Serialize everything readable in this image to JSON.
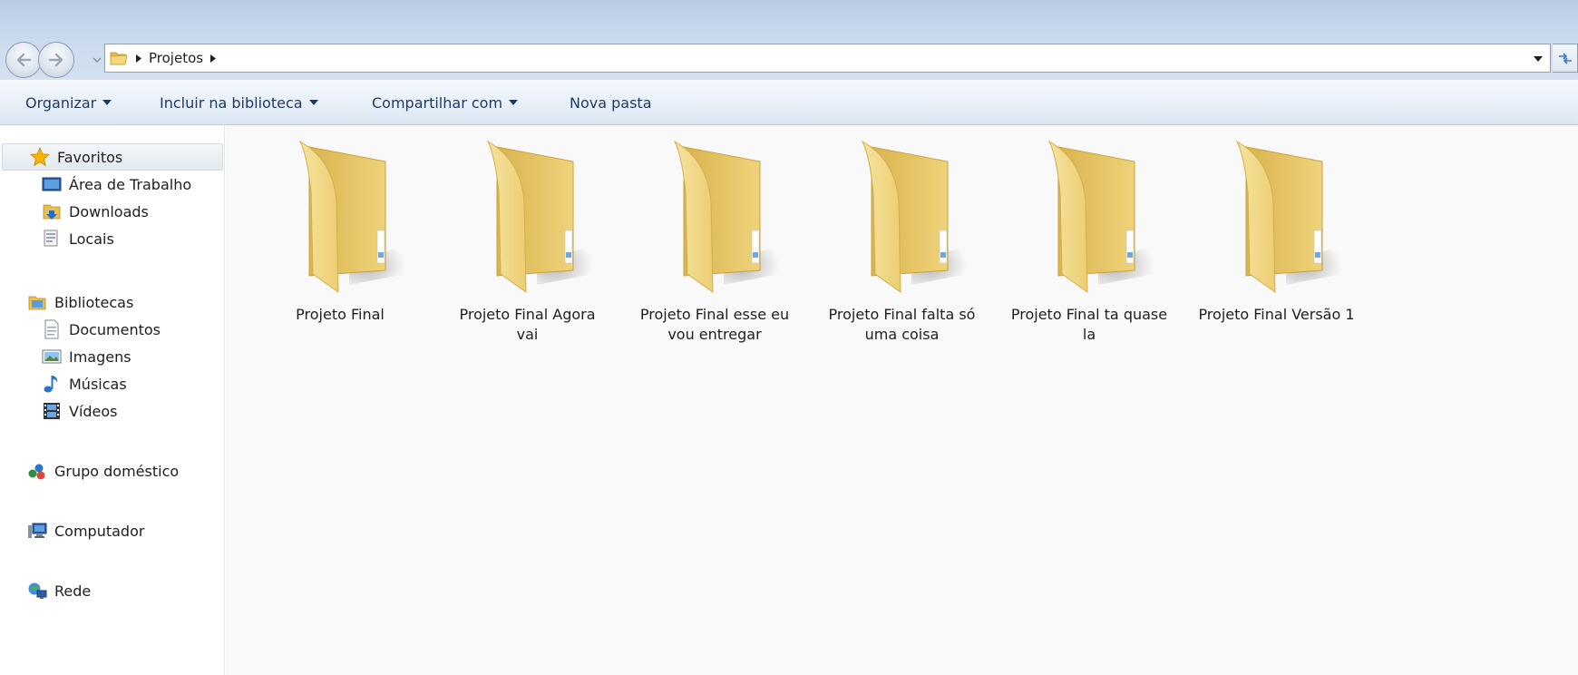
{
  "breadcrumb": {
    "current": "Projetos"
  },
  "toolbar": {
    "organize": "Organizar",
    "include_library": "Incluir na biblioteca",
    "share": "Compartilhar com",
    "new_folder": "Nova pasta"
  },
  "sidebar": {
    "favorites": {
      "label": "Favoritos",
      "items": [
        {
          "label": "Área de Trabalho",
          "icon": "desktop-icon"
        },
        {
          "label": "Downloads",
          "icon": "downloads-folder-icon"
        },
        {
          "label": "Locais",
          "icon": "recent-places-icon"
        }
      ]
    },
    "libraries": {
      "label": "Bibliotecas",
      "items": [
        {
          "label": "Documentos",
          "icon": "documents-icon"
        },
        {
          "label": "Imagens",
          "icon": "pictures-icon"
        },
        {
          "label": "Músicas",
          "icon": "music-note-icon"
        },
        {
          "label": "Vídeos",
          "icon": "video-film-icon"
        }
      ]
    },
    "homegroup": {
      "label": "Grupo doméstico",
      "icon": "homegroup-icon"
    },
    "computer": {
      "label": "Computador",
      "icon": "computer-icon"
    },
    "network": {
      "label": "Rede",
      "icon": "network-icon"
    }
  },
  "folders": [
    {
      "name": "Projeto Final"
    },
    {
      "name": "Projeto Final Agora vai"
    },
    {
      "name": "Projeto Final esse eu vou entregar"
    },
    {
      "name": "Projeto Final falta só uma coisa"
    },
    {
      "name": "Projeto Final ta quase la"
    },
    {
      "name": "Projeto Final Versão 1"
    }
  ],
  "colors": {
    "folder_front": "#f1d77a",
    "folder_back": "#e6c25a",
    "titlebar": "#c8d8ec",
    "content_bg": "#f9f9f9"
  }
}
